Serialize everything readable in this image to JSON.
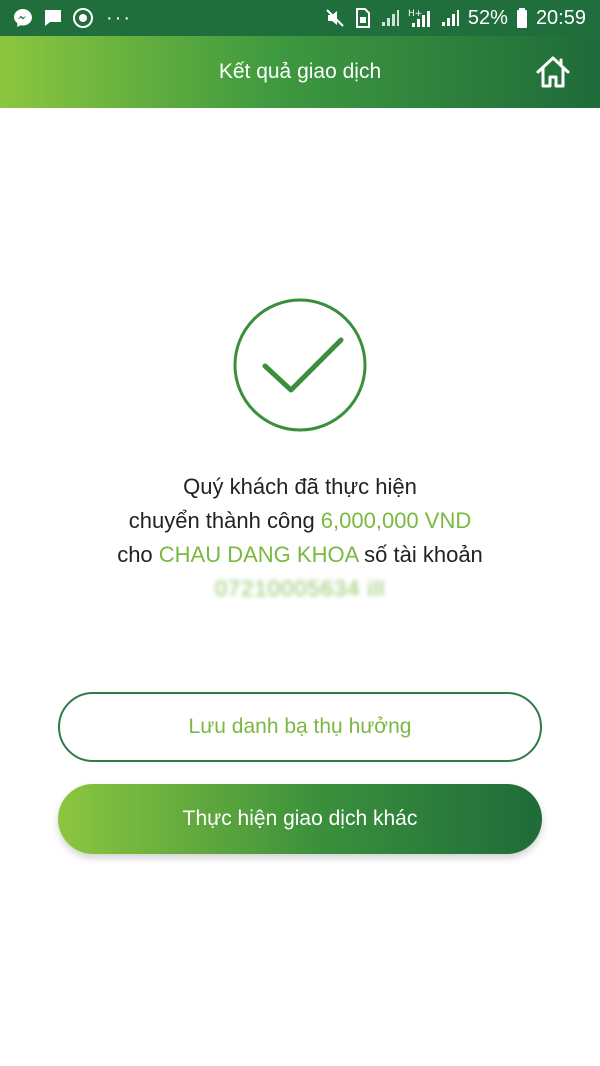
{
  "status_bar": {
    "icons_left": [
      "messenger-icon",
      "chat-icon",
      "eye-icon",
      "more-dots-icon"
    ],
    "dots": "···",
    "icons_right": [
      "mute-icon",
      "sim-icon",
      "signal-icon",
      "hplus-signal-icon",
      "signal-icon-2",
      "battery-icon"
    ],
    "battery": "52%",
    "time": "20:59"
  },
  "header": {
    "title": "Kết quả giao dịch",
    "home_icon": "home-icon"
  },
  "result": {
    "icon": "checkmark-circle-icon",
    "line1": "Quý khách đã thực hiện",
    "line2_prefix": "chuyển thành công ",
    "amount": "6,000,000 VND",
    "line3_prefix": "cho ",
    "recipient": "CHAU DANG KHOA",
    "line3_suffix": " số tài khoản",
    "account_number": "07210005634 ill"
  },
  "buttons": {
    "save_beneficiary": "Lưu danh bạ thụ hưởng",
    "new_transaction": "Thực hiện giao dịch khác"
  },
  "colors": {
    "accent_green": "#7ab93f",
    "dark_green": "#1f6b3a",
    "light_green": "#8cc63f"
  }
}
